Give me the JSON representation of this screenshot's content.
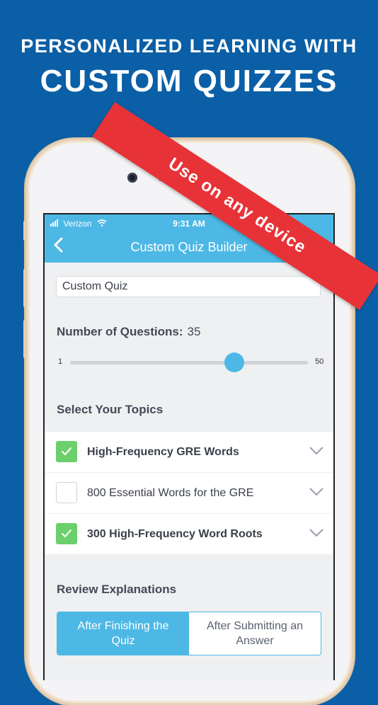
{
  "headline": {
    "line1": "PERSONALIZED LEARNING WITH",
    "line2": "CUSTOM QUIZZES"
  },
  "ribbon": {
    "text": "Use on any device",
    "color": "#e73338"
  },
  "status_bar": {
    "carrier": "Verizon",
    "time": "9:31 AM"
  },
  "nav": {
    "back_icon": "chevron-left-icon",
    "title": "Custom Quiz Builder"
  },
  "quiz_name": {
    "value": "Custom Quiz"
  },
  "questions": {
    "label": "Number of Questions:",
    "value": 35,
    "min": "1",
    "max": "50",
    "slider_value": 35
  },
  "topics": {
    "label": "Select Your Topics",
    "items": [
      {
        "label": "High-Frequency GRE Words",
        "checked": true
      },
      {
        "label": "800 Essential Words for the GRE",
        "checked": false
      },
      {
        "label": "300 High-Frequency Word Roots",
        "checked": true
      }
    ]
  },
  "review": {
    "label": "Review Explanations",
    "options": [
      {
        "label": "After Finishing the Quiz",
        "selected": true
      },
      {
        "label": "After Submitting an Answer",
        "selected": false
      }
    ]
  },
  "colors": {
    "background": "#0a5fa6",
    "accent": "#4db8e5",
    "check": "#6bd06b",
    "ribbon": "#e73338"
  }
}
